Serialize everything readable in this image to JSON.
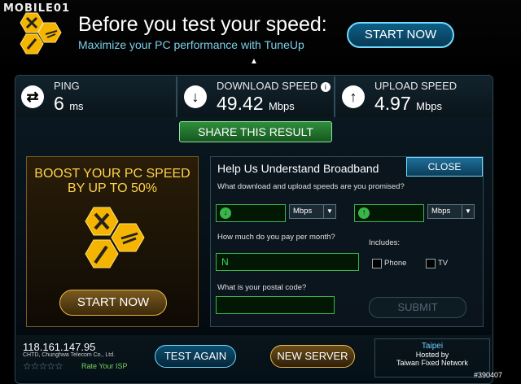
{
  "watermark": "MOBILE01",
  "ad": {
    "title": "Before you test your speed:",
    "subtitle": "Maximize your PC performance with TuneUp",
    "cta": "START NOW"
  },
  "stats": [
    {
      "label": "PING",
      "value": "6",
      "unit": "ms",
      "icon": "swap-arrows-icon"
    },
    {
      "label": "DOWNLOAD SPEED",
      "value": "49.42",
      "unit": "Mbps",
      "icon": "down-arrow-icon"
    },
    {
      "label": "UPLOAD SPEED",
      "value": "4.97",
      "unit": "Mbps",
      "icon": "up-arrow-icon"
    }
  ],
  "share": "SHARE THIS RESULT",
  "boost": {
    "title_line1": "BOOST YOUR PC SPEED",
    "title_line2": "BY UP TO 50%",
    "cta": "START NOW"
  },
  "help": {
    "title": "Help Us Understand Broadband",
    "close": "CLOSE",
    "q_speed": "What download and upload speeds are you promised?",
    "unit_down": "Mbps",
    "unit_up": "Mbps",
    "q_pay": "How much do you pay per month?",
    "pay_value": "N",
    "includes": "Includes:",
    "opt_phone": "Phone",
    "opt_tv": "TV",
    "q_postal": "What is your postal code?",
    "submit": "SUBMIT"
  },
  "bottom": {
    "ip": "118.161.147.95",
    "isp": "CHTD, Chunghwa Telecom Co., Ltd.",
    "stars": "☆☆☆☆☆",
    "rate": "Rate Your ISP",
    "test_again": "TEST AGAIN",
    "new_server": "NEW SERVER",
    "city": "Taipei",
    "hosted1": "Hosted by",
    "hosted2": "Taiwan Fixed Network"
  },
  "image_id_text": "#390407"
}
